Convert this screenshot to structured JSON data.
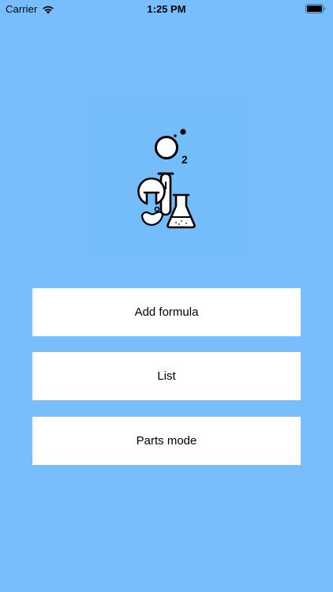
{
  "status_bar": {
    "carrier": "Carrier",
    "time": "1:25 PM",
    "wifi_icon": "wifi-icon",
    "battery_icon": "battery-icon"
  },
  "logo": {
    "icon": "chemistry-flasks-o2-icon",
    "subscript": "2"
  },
  "menu": {
    "add_formula": "Add formula",
    "list": "List",
    "parts_mode": "Parts mode"
  },
  "colors": {
    "background": "#78befc",
    "button": "#ffffff",
    "text": "#000000"
  }
}
